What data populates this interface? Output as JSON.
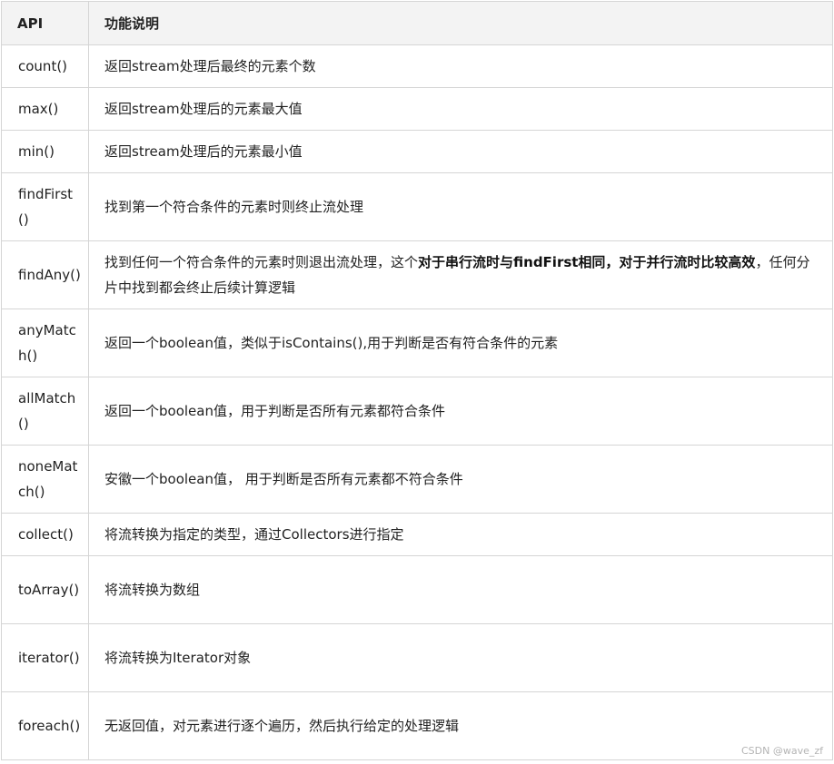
{
  "table": {
    "headers": [
      "API",
      "功能说明"
    ],
    "rows": [
      {
        "api": "count()",
        "desc": "返回stream处理后最终的元素个数"
      },
      {
        "api": "max()",
        "desc": "返回stream处理后的元素最大值"
      },
      {
        "api": "min()",
        "desc": "返回stream处理后的元素最小值"
      },
      {
        "api": "findFirst()",
        "desc": "找到第一个符合条件的元素时则终止流处理"
      },
      {
        "api": "findAny()",
        "desc_a": "找到任何一个符合条件的元素时则退出流处理，这个",
        "desc_bold": "对于串行流时与findFirst相同，对于并行流时比较高效",
        "desc_b": "，任何分片中找到都会终止后续计算逻辑"
      },
      {
        "api": "anyMatch()",
        "desc": "返回一个boolean值，类似于isContains(),用于判断是否有符合条件的元素"
      },
      {
        "api": "allMatch()",
        "desc": "返回一个boolean值，用于判断是否所有元素都符合条件"
      },
      {
        "api": "noneMatch()",
        "desc": "安徽一个boolean值， 用于判断是否所有元素都不符合条件"
      },
      {
        "api": "collect()",
        "desc": "将流转换为指定的类型，通过Collectors进行指定"
      },
      {
        "api": "toArray()",
        "desc": "将流转换为数组"
      },
      {
        "api": "iterator()",
        "desc": "将流转换为Iterator对象"
      },
      {
        "api": "foreach()",
        "desc": "无返回值，对元素进行逐个遍历，然后执行给定的处理逻辑"
      }
    ]
  },
  "watermark": "CSDN @wave_zf"
}
